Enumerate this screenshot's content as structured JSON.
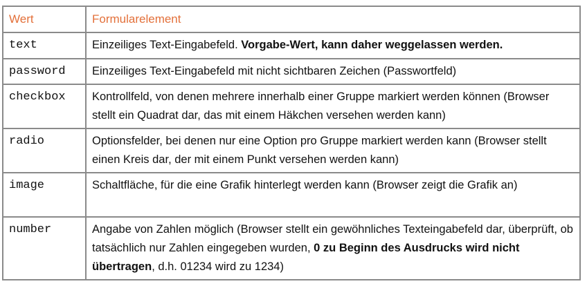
{
  "table": {
    "header": {
      "col_value": "Wert",
      "col_element": "Formularelement"
    },
    "rows": [
      {
        "value": "text",
        "desc_a": "Einzeiliges Text-Eingabefeld. ",
        "desc_bold": "Vorgabe-Wert, kann daher weggelassen werden."
      },
      {
        "value": "password",
        "desc_a": "Einzeiliges Text-Eingabefeld mit nicht sichtbaren Zeichen (Passwortfeld)"
      },
      {
        "value": "checkbox",
        "desc_a": "Kontrollfeld, von denen mehrere innerhalb einer Gruppe markiert werden können (Browser stellt ein Quadrat dar, das mit einem Häkchen versehen werden kann)"
      },
      {
        "value": "radio",
        "desc_a": "Optionsfelder, bei denen nur eine Option pro Gruppe markiert werden kann (Browser stellt einen Kreis dar, der mit einem Punkt versehen werden kann)"
      },
      {
        "value": "image",
        "desc_a": "Schaltfläche, für die eine Grafik hinterlegt werden kann (Browser zeigt die Grafik an)"
      },
      {
        "value": "number",
        "desc_a": "Angabe von Zahlen möglich (Browser stellt ein gewöhnliches Texteingabefeld dar, überprüft, ob tatsächlich nur Zahlen eingegeben wurden, ",
        "desc_bold": "0 zu Beginn des Ausdrucks wird nicht übertragen",
        "desc_b": ", d.h. 01234 wird zu 1234)"
      }
    ]
  },
  "colors": {
    "header_text": "#e3703a",
    "border": "#8a8a8a"
  }
}
